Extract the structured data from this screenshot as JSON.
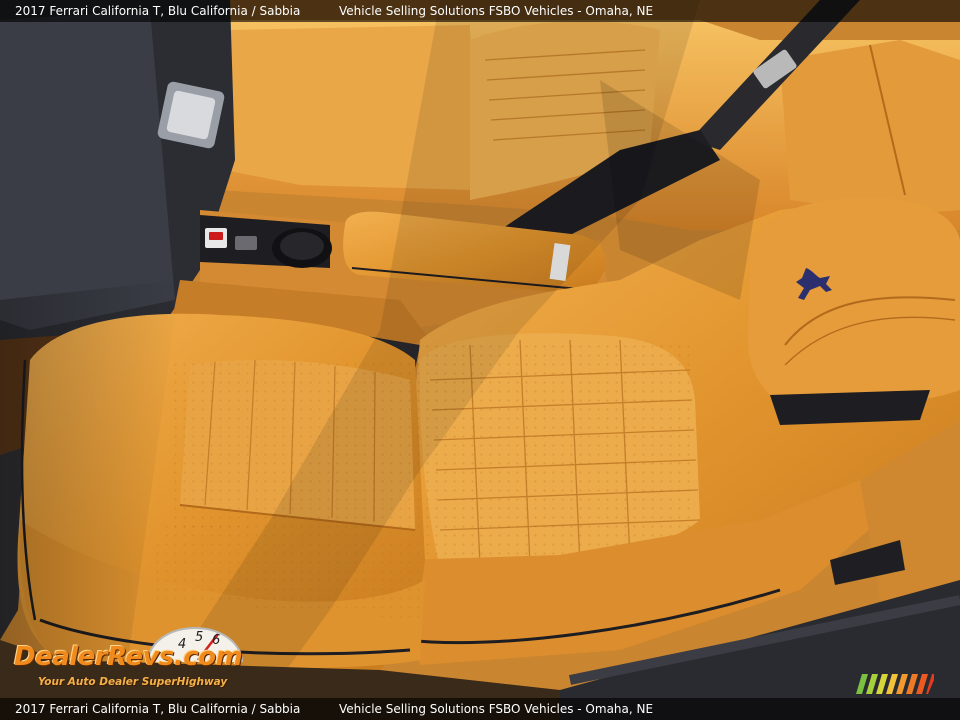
{
  "caption": {
    "vehicle": "2017 Ferrari California T,  Blu California / Sabbia",
    "dealer": "Vehicle Selling Solutions FSBO Vehicles - Omaha, NE"
  },
  "logo": {
    "wordmark": "DealerRevs.com",
    "tagline": "Your Auto Dealer SuperHighway",
    "gauge_digits": [
      "4",
      "5",
      "6"
    ]
  },
  "colors": {
    "leather": "#e2952e",
    "leather_shadow": "#a65d14",
    "piping": "#1d1d22",
    "logo_orange": "#f08a1c"
  },
  "icons": [
    "prancing-horse-icon",
    "tachometer-gauge-icon",
    "speed-stripes-icon"
  ]
}
